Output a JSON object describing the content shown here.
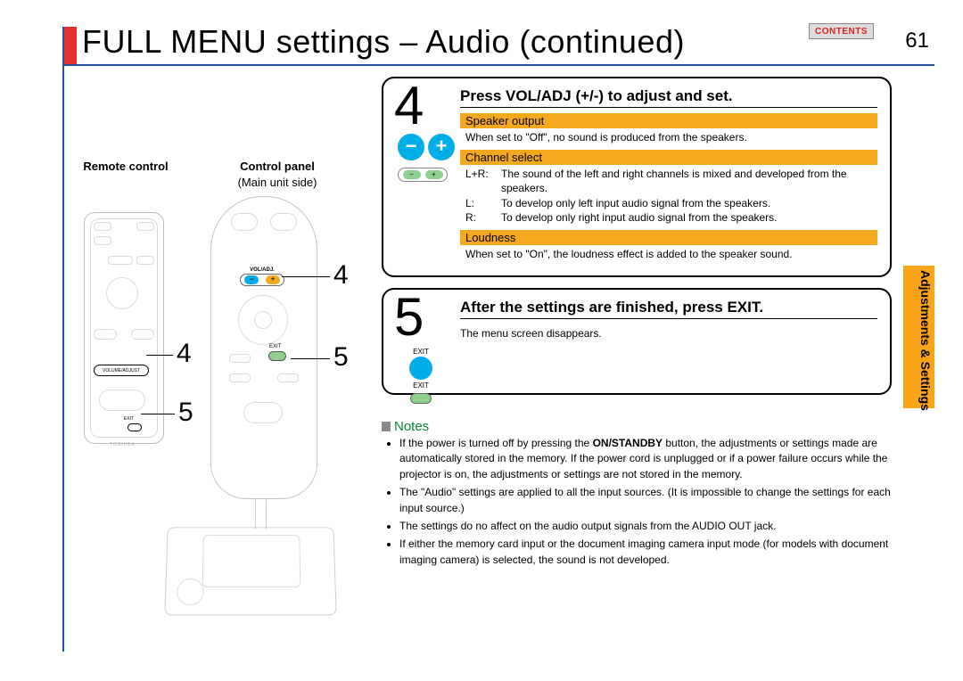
{
  "header": {
    "title": "FULL MENU settings – Audio (continued)",
    "contents_button": "CONTENTS",
    "page_number": "61",
    "side_tab": "Adjustments & Settings"
  },
  "leftcol": {
    "remote_label": "Remote control",
    "control_panel_label": "Control panel",
    "control_panel_sub": "(Main unit side)",
    "vol_adj_label": "VOL/ADJ.",
    "volume_label": "VOLUME/ADJUST",
    "exit_label": "EXIT",
    "brand": "TOSHIBA",
    "callout_4a": "4",
    "callout_5a": "5",
    "callout_4b": "4",
    "callout_5b": "5"
  },
  "step4": {
    "number": "4",
    "heading": "Press VOL/ADJ (+/-) to adjust and set.",
    "minus": "−",
    "plus": "+",
    "pill_minus": "−",
    "pill_plus": "+",
    "settings": {
      "speaker_output": {
        "title": "Speaker output",
        "desc": "When set to \"Off\", no sound is produced from the speakers."
      },
      "channel_select": {
        "title": "Channel select",
        "rows": [
          {
            "key": "L+R:",
            "text": "The sound of the left and right channels is mixed and developed from the speakers."
          },
          {
            "key": "L:",
            "text": "To develop only left input audio signal from the speakers."
          },
          {
            "key": "R:",
            "text": "To develop only right input audio signal from the speakers."
          }
        ]
      },
      "loudness": {
        "title": "Loudness",
        "desc": "When set to \"On\", the loudness effect is added to the speaker sound."
      }
    }
  },
  "step5": {
    "number": "5",
    "heading": "After the settings are finished, press EXIT.",
    "desc": "The menu screen disappears.",
    "exit_cap": "EXIT",
    "exit_cap2": "EXIT"
  },
  "notes": {
    "title": "Notes",
    "items": [
      "If the power is turned off by pressing the ON/STANDBY button, the adjustments or settings made are automatically stored in the memory. If the power cord is unplugged or if a power failure occurs while the projector is on, the adjustments or settings are not stored in the memory.",
      "The \"Audio\" settings are applied to all the input sources. (It is impossible to change the settings for each input source.)",
      "The settings do no affect on the audio output signals from the AUDIO OUT jack.",
      "If either the memory card input or the document imaging camera input mode (for models with document imaging camera) is selected, the sound is not developed."
    ],
    "bold_button": "ON/STANDBY"
  }
}
